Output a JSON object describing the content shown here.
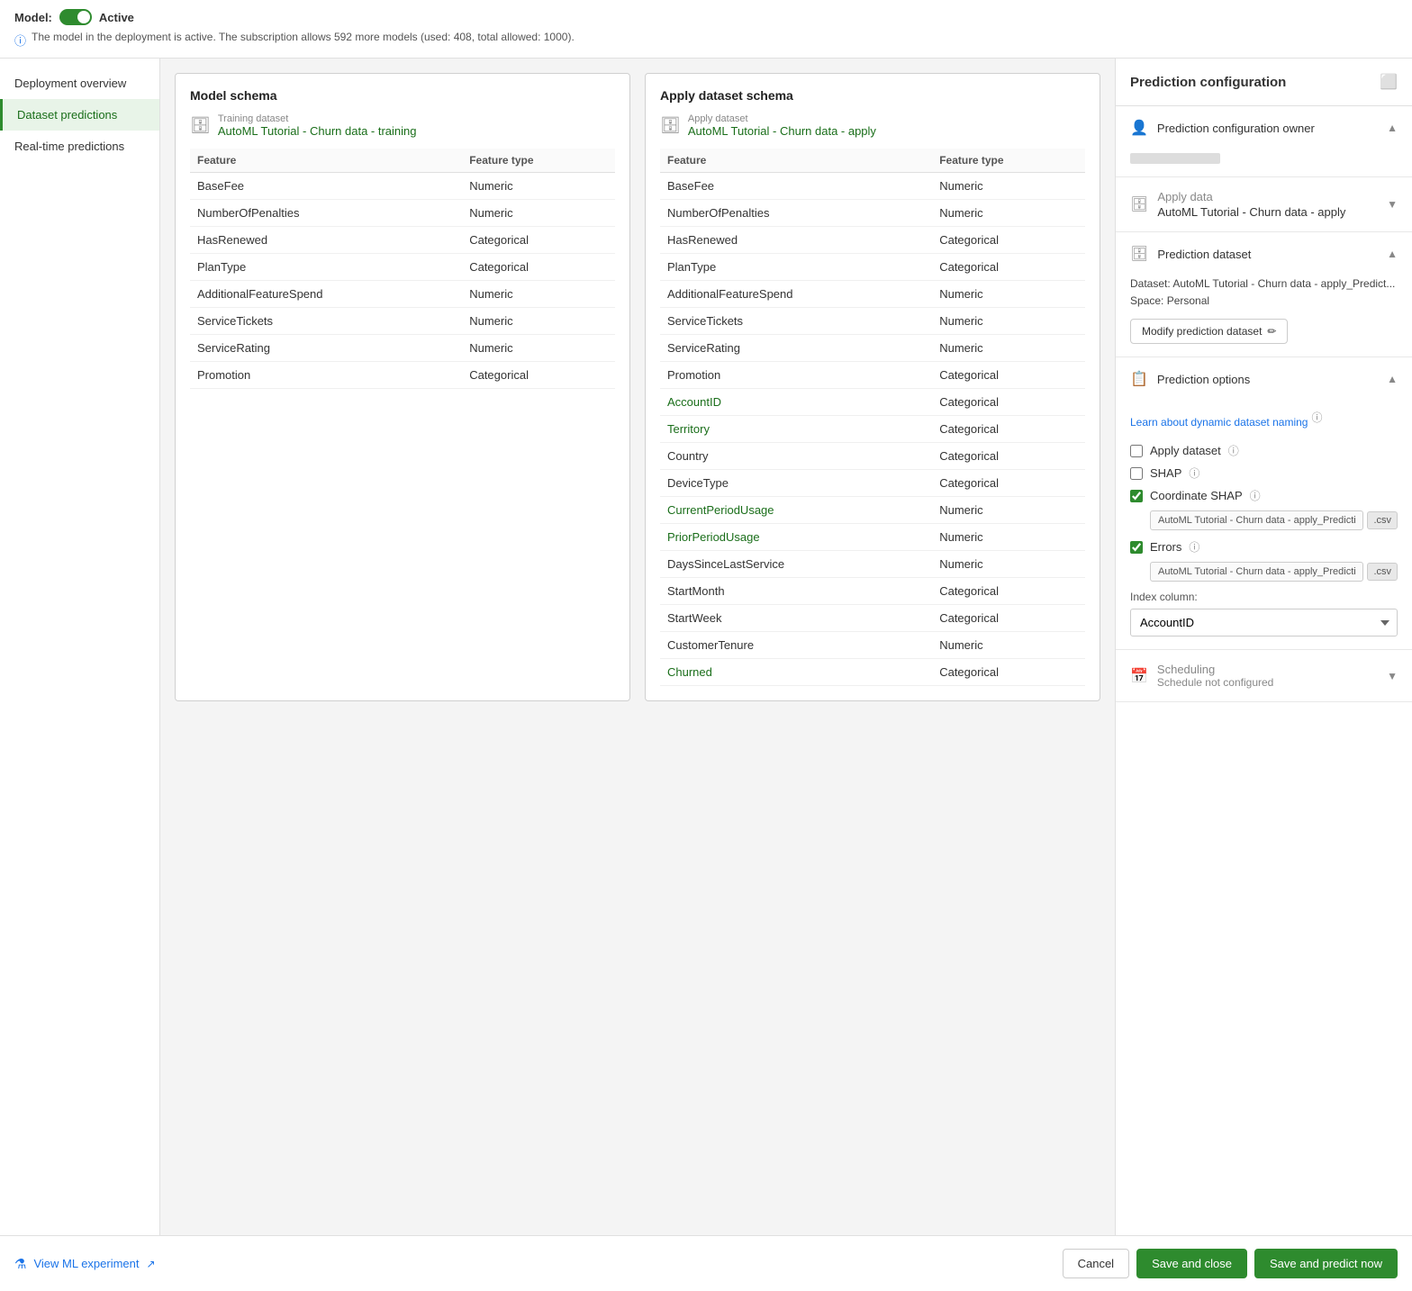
{
  "topbar": {
    "model_label": "Model:",
    "status": "Active",
    "info_text": "The model in the deployment is active. The subscription allows 592 more models (used: 408, total allowed: 1000)."
  },
  "sidebar": {
    "items": [
      {
        "id": "deployment-overview",
        "label": "Deployment overview",
        "active": false
      },
      {
        "id": "dataset-predictions",
        "label": "Dataset predictions",
        "active": true
      },
      {
        "id": "realtime-predictions",
        "label": "Real-time predictions",
        "active": false
      }
    ]
  },
  "model_schema": {
    "title": "Model schema",
    "source_label": "Training dataset",
    "source_name": "AutoML Tutorial - Churn data - training",
    "columns": [
      "Feature",
      "Feature type"
    ],
    "rows": [
      {
        "feature": "BaseFee",
        "type": "Numeric",
        "green": false
      },
      {
        "feature": "NumberOfPenalties",
        "type": "Numeric",
        "green": false
      },
      {
        "feature": "HasRenewed",
        "type": "Categorical",
        "green": false
      },
      {
        "feature": "PlanType",
        "type": "Categorical",
        "green": false
      },
      {
        "feature": "AdditionalFeatureSpend",
        "type": "Numeric",
        "green": false
      },
      {
        "feature": "ServiceTickets",
        "type": "Numeric",
        "green": false
      },
      {
        "feature": "ServiceRating",
        "type": "Numeric",
        "green": false
      },
      {
        "feature": "Promotion",
        "type": "Categorical",
        "green": false
      }
    ]
  },
  "apply_schema": {
    "title": "Apply dataset schema",
    "source_label": "Apply dataset",
    "source_name": "AutoML Tutorial - Churn data - apply",
    "columns": [
      "Feature",
      "Feature type"
    ],
    "rows": [
      {
        "feature": "BaseFee",
        "type": "Numeric",
        "green": false
      },
      {
        "feature": "NumberOfPenalties",
        "type": "Numeric",
        "green": false
      },
      {
        "feature": "HasRenewed",
        "type": "Categorical",
        "green": false
      },
      {
        "feature": "PlanType",
        "type": "Categorical",
        "green": false
      },
      {
        "feature": "AdditionalFeatureSpend",
        "type": "Numeric",
        "green": false
      },
      {
        "feature": "ServiceTickets",
        "type": "Numeric",
        "green": false
      },
      {
        "feature": "ServiceRating",
        "type": "Numeric",
        "green": false
      },
      {
        "feature": "Promotion",
        "type": "Categorical",
        "green": false
      },
      {
        "feature": "AccountID",
        "type": "Categorical",
        "green": true
      },
      {
        "feature": "Territory",
        "type": "Categorical",
        "green": true
      },
      {
        "feature": "Country",
        "type": "Categorical",
        "green": false
      },
      {
        "feature": "DeviceType",
        "type": "Categorical",
        "green": false
      },
      {
        "feature": "CurrentPeriodUsage",
        "type": "Numeric",
        "green": true
      },
      {
        "feature": "PriorPeriodUsage",
        "type": "Numeric",
        "green": true
      },
      {
        "feature": "DaysSinceLastService",
        "type": "Numeric",
        "green": false
      },
      {
        "feature": "StartMonth",
        "type": "Categorical",
        "green": false
      },
      {
        "feature": "StartWeek",
        "type": "Categorical",
        "green": false
      },
      {
        "feature": "CustomerTenure",
        "type": "Numeric",
        "green": false
      },
      {
        "feature": "Churned",
        "type": "Categorical",
        "green": true
      }
    ]
  },
  "right_panel": {
    "title": "Prediction configuration",
    "sections": {
      "owner": {
        "label": "Prediction configuration owner",
        "chevron": "▲"
      },
      "apply_data": {
        "label": "Apply data",
        "value": "AutoML Tutorial - Churn data - apply",
        "chevron": "▼"
      },
      "prediction_dataset": {
        "label": "Prediction dataset",
        "dataset_text": "Dataset: AutoML Tutorial - Churn data - apply_Predict...",
        "space_text": "Space: Personal",
        "modify_btn": "Modify prediction dataset",
        "chevron": "▲"
      },
      "prediction_options": {
        "label": "Prediction options",
        "learn_link": "Learn about dynamic dataset naming",
        "apply_dataset_label": "Apply dataset",
        "shap_label": "SHAP",
        "coordinate_shap_label": "Coordinate SHAP",
        "coordinate_shap_value": "AutoML Tutorial - Churn data - apply_Predictic",
        "coordinate_shap_ext": ".csv",
        "errors_label": "Errors",
        "errors_value": "AutoML Tutorial - Churn data - apply_Predictic",
        "errors_ext": ".csv",
        "index_col_label": "Index column:",
        "index_col_value": "AccountID",
        "chevron": "▲"
      },
      "scheduling": {
        "label": "Scheduling",
        "subtitle": "Schedule not configured",
        "chevron": "▼"
      }
    }
  },
  "bottom": {
    "view_experiment": "View ML experiment",
    "cancel": "Cancel",
    "save_close": "Save and close",
    "save_predict": "Save and predict now"
  }
}
